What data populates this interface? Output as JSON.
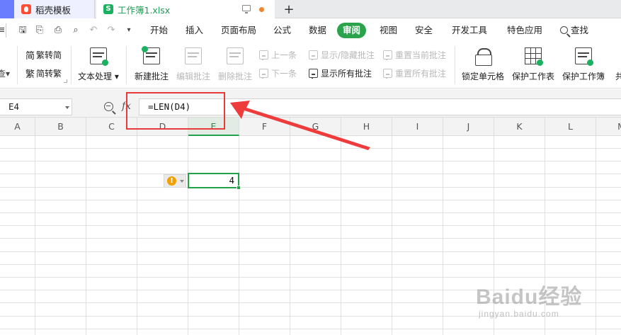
{
  "tabs": {
    "docer_label": "稻壳模板",
    "workbook_label": "工作簿1.xlsx",
    "workbook_icon_letter": "S",
    "add_label": "+"
  },
  "menu": {
    "items": [
      "开始",
      "插入",
      "页面布局",
      "公式",
      "数据",
      "审阅",
      "视图",
      "安全",
      "开发工具",
      "特色应用"
    ],
    "active": "审阅",
    "search_label": "查找"
  },
  "ribbon": {
    "trad_to_simp": "繁转简",
    "simp_to_trad": "简转繁",
    "text_processing": "文本处理",
    "new_comment": "新建批注",
    "edit_comment": "编辑批注",
    "delete_comment": "删除批注",
    "prev_item": "上一条",
    "next_item": "下一条",
    "show_hide_comment": "显示/隐藏批注",
    "show_all_comments": "显示所有批注",
    "reset_current_comment": "重置当前批注",
    "reset_all_comments": "重置所有批注",
    "lock_cell": "锁定单元格",
    "protect_sheet": "保护工作表",
    "protect_workbook": "保护工作簿",
    "share_partial": "共",
    "left_partial": "查",
    "trad_glyph": "简",
    "simp_glyph": "繁"
  },
  "formula_bar": {
    "name_box": "E4",
    "fx_label": "fx",
    "formula": "=LEN(D4)"
  },
  "grid": {
    "columns": [
      "A",
      "B",
      "C",
      "D",
      "E",
      "F",
      "G",
      "H",
      "I",
      "J",
      "K",
      "L",
      "M"
    ],
    "active_column": "E",
    "active_cell_value": "4"
  },
  "error_tag": {
    "icon": "!"
  },
  "watermark": {
    "brand": "Baidu经验",
    "site": "jingyan.baidu.com"
  },
  "colors": {
    "accent_green": "#2ba24c",
    "highlight_red": "#e83a3a"
  }
}
